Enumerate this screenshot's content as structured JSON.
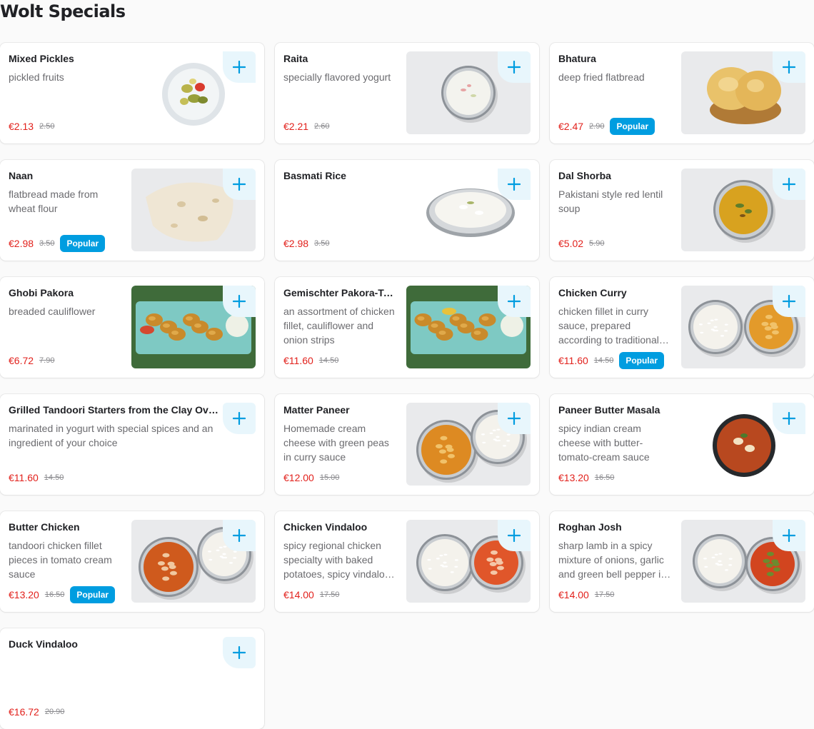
{
  "section": {
    "title": "Wolt Specials"
  },
  "colors": {
    "accent": "#009de0",
    "price": "#e2211c",
    "add_bg": "#e8f6fc"
  },
  "icons": {
    "add": "plus-icon"
  },
  "items": [
    {
      "name": "Mixed Pickles",
      "description": "pickled fruits",
      "price": "€2.13",
      "old_price": "2.50",
      "badge": "",
      "image": "mixed-pickles-dish"
    },
    {
      "name": "Raita",
      "description": "specially flavored yogurt",
      "price": "€2.21",
      "old_price": "2.60",
      "badge": "",
      "image": "raita-bowl"
    },
    {
      "name": "Bhatura",
      "description": "deep fried flatbread",
      "price": "€2.47",
      "old_price": "2.90",
      "badge": "Popular",
      "image": "bhatura-basket"
    },
    {
      "name": "Naan",
      "description": "flatbread made from wheat flour",
      "price": "€2.98",
      "old_price": "3.50",
      "badge": "Popular",
      "image": "naan-bread"
    },
    {
      "name": "Basmati Rice",
      "description": "",
      "price": "€2.98",
      "old_price": "3.50",
      "badge": "",
      "image": "basmati-rice-plate"
    },
    {
      "name": "Dal Shorba",
      "description": "Pakistani style red lentil soup",
      "price": "€5.02",
      "old_price": "5.90",
      "badge": "",
      "image": "dal-shorba-bowl"
    },
    {
      "name": "Ghobi Pakora",
      "description": "breaded cauliflower",
      "price": "€6.72",
      "old_price": "7.90",
      "badge": "",
      "image": "ghobi-pakora-platter"
    },
    {
      "name": "Gemischter Pakora-Teller",
      "description": "an assortment of chicken fillet, cauliflower and onion strips",
      "price": "€11.60",
      "old_price": "14.50",
      "badge": "",
      "image": "pakora-platter"
    },
    {
      "name": "Chicken Curry",
      "description": "chicken fillet in curry sauce, prepared according to traditional recipe",
      "price": "€11.60",
      "old_price": "14.50",
      "badge": "Popular",
      "image": "chicken-curry-with-rice"
    },
    {
      "name": "Grilled Tandoori Starters from the Clay Oven",
      "description": "marinated in yogurt with special spices and an ingredient of your choice",
      "price": "€11.60",
      "old_price": "14.50",
      "badge": "",
      "image": ""
    },
    {
      "name": "Matter Paneer",
      "description": "Homemade cream cheese with green peas in curry sauce",
      "price": "€12.00",
      "old_price": "15.00",
      "badge": "",
      "image": "matter-paneer-with-rice"
    },
    {
      "name": "Paneer Butter Masala",
      "description": "spicy indian cream cheese with butter-tomato-cream sauce",
      "price": "€13.20",
      "old_price": "16.50",
      "badge": "",
      "image": "paneer-butter-masala-bowl"
    },
    {
      "name": "Butter Chicken",
      "description": "tandoori chicken fillet pieces in tomato cream sauce",
      "price": "€13.20",
      "old_price": "16.50",
      "badge": "Popular",
      "image": "butter-chicken-with-rice"
    },
    {
      "name": "Chicken Vindaloo",
      "description": "spicy regional chicken specialty with baked potatoes, spicy vindaloo sauce",
      "price": "€14.00",
      "old_price": "17.50",
      "badge": "",
      "image": "chicken-vindaloo-with-rice"
    },
    {
      "name": "Roghan Josh",
      "description": "sharp lamb in a spicy mixture of onions, garlic and green bell pepper in sauce",
      "price": "€14.00",
      "old_price": "17.50",
      "badge": "",
      "image": "roghan-josh-with-rice"
    },
    {
      "name": "Duck Vindaloo",
      "description": "",
      "price": "€16.72",
      "old_price": "20.90",
      "badge": "",
      "image": ""
    }
  ]
}
